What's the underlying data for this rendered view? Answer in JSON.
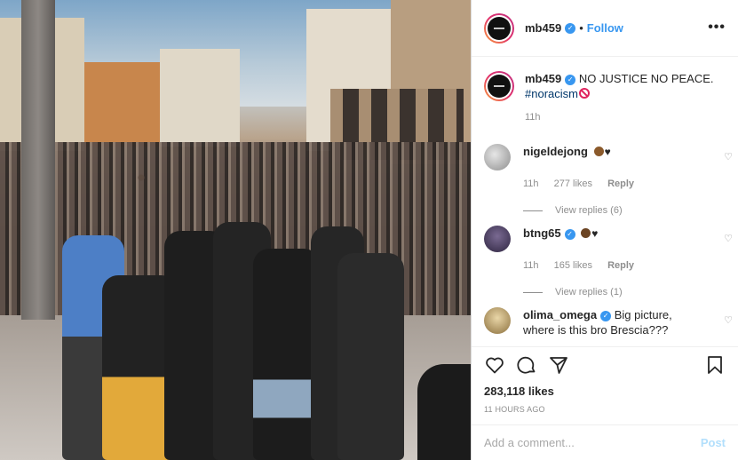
{
  "post": {
    "username": "mb459",
    "verified_badge": "✓",
    "follow_label": "Follow",
    "dot": "•",
    "more_label": "•••"
  },
  "caption": {
    "username": "mb459",
    "text": "NO JUSTICE NO PEACE.",
    "hashtag": "#noracism",
    "icon": "prohibited-icon",
    "time": "11h"
  },
  "comments": [
    {
      "username": "nigeldejong",
      "text": "",
      "emojis": [
        "raised-fist-icon",
        "black-heart-icon"
      ],
      "time": "11h",
      "likes": "277 likes",
      "reply_label": "Reply",
      "view_replies": "View replies (6)",
      "avatar_color": "#c9c9c9"
    },
    {
      "username": "btng65",
      "verified": true,
      "text": "",
      "emojis": [
        "raised-fist-icon",
        "black-heart-icon"
      ],
      "time": "11h",
      "likes": "165 likes",
      "reply_label": "Reply",
      "view_replies": "View replies (1)",
      "avatar_color": "#5a4b6e"
    },
    {
      "username": "olima_omega",
      "verified": true,
      "text": "Big picture, where is this bro Brescia???",
      "avatar_color": "#c8b07a"
    }
  ],
  "actions": {
    "like_icon": "heart-outline-icon",
    "comment_icon": "comment-bubble-icon",
    "share_icon": "paper-plane-icon",
    "save_icon": "bookmark-icon"
  },
  "stats": {
    "likes": "283,118 likes",
    "ago": "11 HOURS AGO"
  },
  "add_comment": {
    "placeholder": "Add a comment...",
    "post_label": "Post"
  },
  "colors": {
    "accent": "#3897f0",
    "hashtag": "#00376b",
    "muted": "#8e8e8e",
    "post_disabled": "#b2dffc"
  }
}
